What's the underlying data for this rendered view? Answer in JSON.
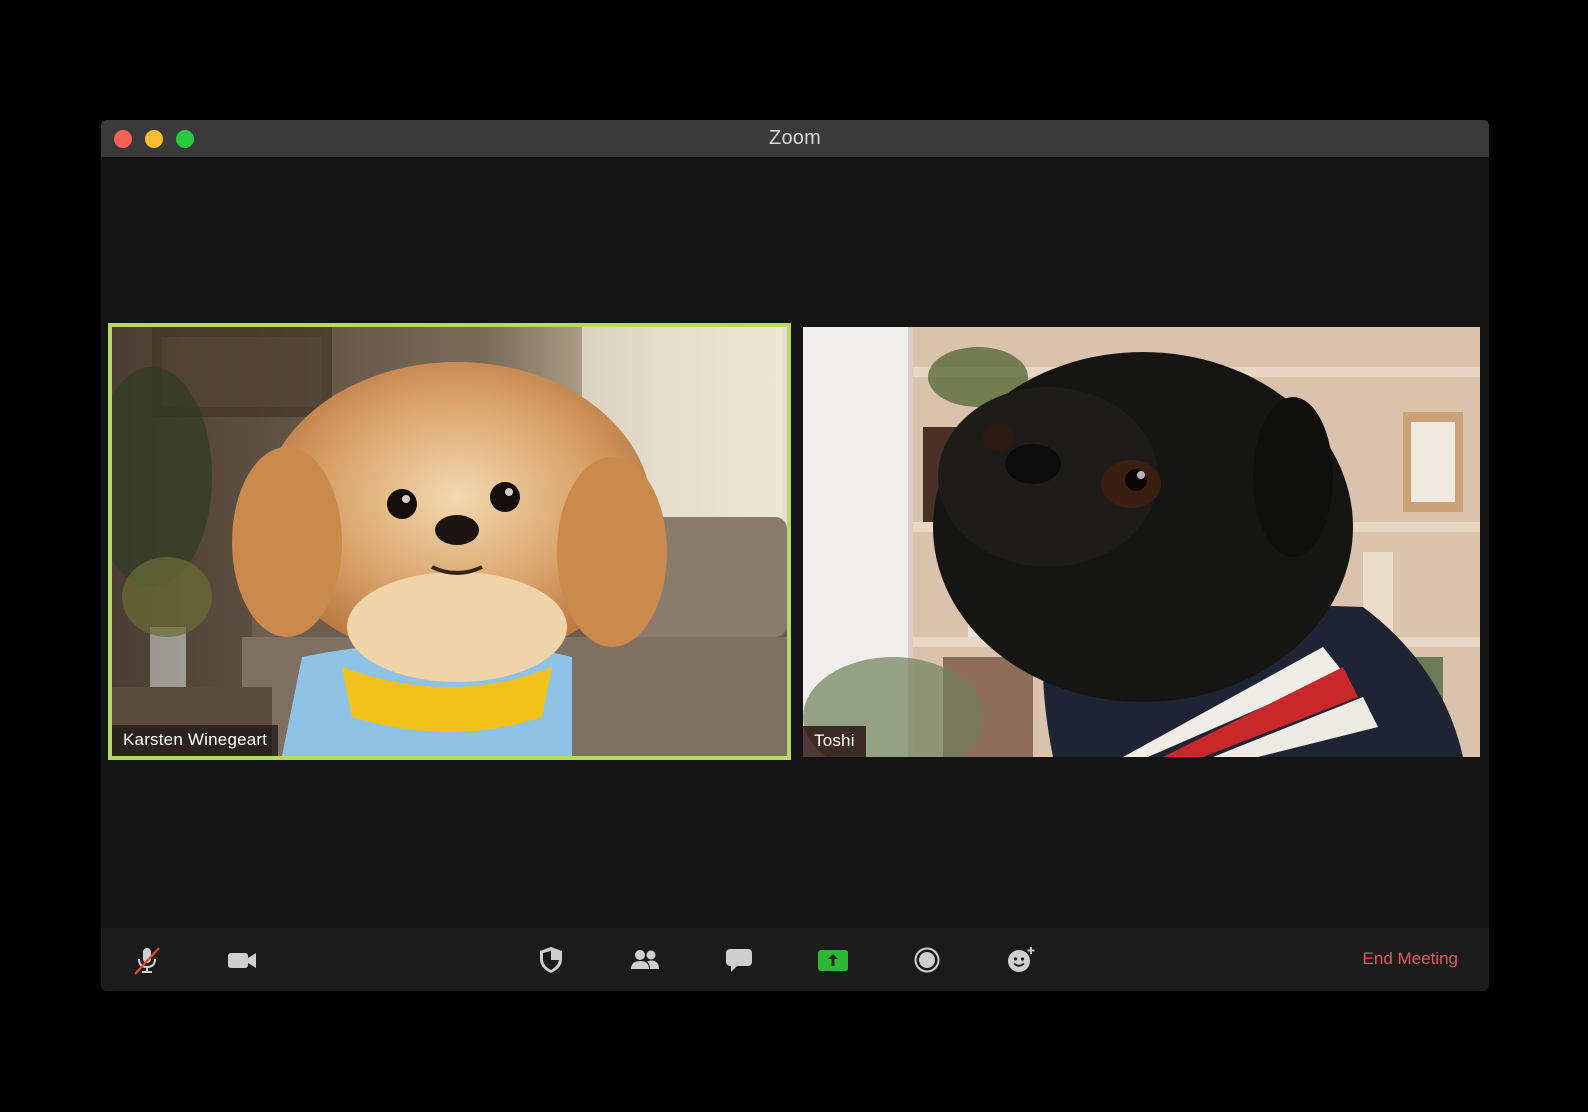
{
  "window": {
    "title": "Zoom"
  },
  "participants": [
    {
      "name": "Karsten Winegeart",
      "active_speaker": true
    },
    {
      "name": "Toshi",
      "active_speaker": false
    }
  ],
  "toolbar": {
    "buttons": [
      {
        "icon": "mic-muted-icon"
      },
      {
        "icon": "video-camera-icon"
      },
      {
        "icon": "security-shield-icon"
      },
      {
        "icon": "participants-icon"
      },
      {
        "icon": "chat-bubble-icon"
      },
      {
        "icon": "share-screen-icon"
      },
      {
        "icon": "record-icon"
      },
      {
        "icon": "reactions-icon"
      }
    ],
    "end_label": "End Meeting"
  },
  "colors": {
    "active_border": "#b5d86b",
    "end_meeting": "#e05a5a",
    "share_green": "#2fb636"
  }
}
